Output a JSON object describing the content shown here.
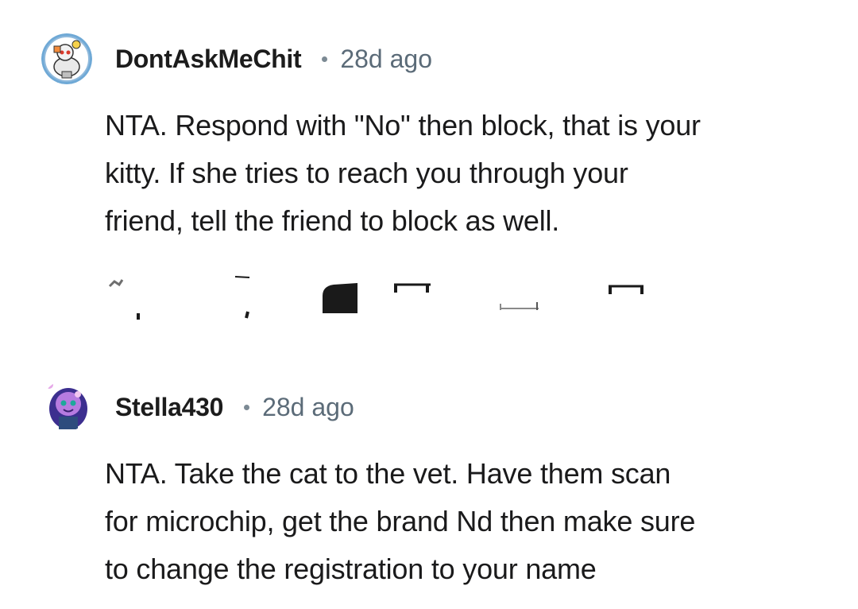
{
  "comments": [
    {
      "username": "DontAskMeChit",
      "timestamp": "28d ago",
      "lines": [
        "NTA. Respond with \"No\" then block, that is your",
        "kitty. If she tries to reach you through your",
        "friend, tell the friend to block as well."
      ],
      "avatar_icon": "snoo-avatar-icon"
    },
    {
      "username": "Stella430",
      "timestamp": "28d ago",
      "lines": [
        "NTA. Take the cat to the vet. Have them scan",
        "for microchip, get the brand Nd then make sure",
        "to change the registration to your name"
      ],
      "avatar_icon": "snoo-avatar-icon"
    }
  ],
  "colors": {
    "text": "#1a1a1b",
    "username": "#1c1c1c",
    "muted": "#5b6b78",
    "background": "#ffffff"
  }
}
